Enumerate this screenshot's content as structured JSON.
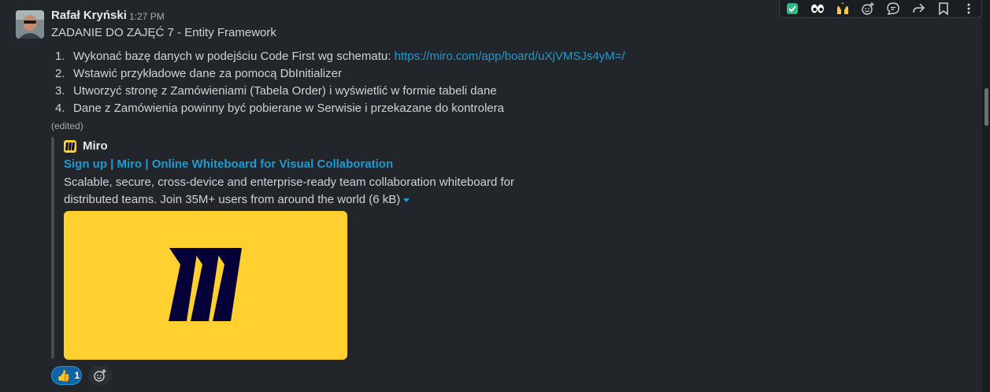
{
  "message": {
    "author": "Rafał Kryński",
    "time": "1:27 PM",
    "title": "ZADANIE DO ZAJĘĆ 7 - Entity Framework",
    "edited": "(edited)",
    "tasks": [
      {
        "num": "1.",
        "text": "Wykonać bazę danych w podejściu Code First wg schematu: ",
        "link": "https://miro.com/app/board/uXjVMSJs4yM=/"
      },
      {
        "num": "2.",
        "text": "Wstawić przykładowe dane za pomocą DbInitializer"
      },
      {
        "num": "3.",
        "text": "Utworzyć stronę z Zamówieniami (Tabela Order) i wyświetlić w formie tabeli dane"
      },
      {
        "num": "4.",
        "text": "Dane z Zamówienia powinny być pobierane w Serwisie i przekazane do kontrolera"
      }
    ]
  },
  "unfurl": {
    "site_name": "Miro",
    "title": "Sign up | Miro | Online Whiteboard for Visual Collaboration",
    "description": "Scalable, secure, cross-device and enterprise-ready team collaboration whiteboard for distributed teams. Join 35M+ users from around the world (6 kB)",
    "preview_icon": "miro-logo-icon"
  },
  "reactions": [
    {
      "emoji": "👍",
      "count": "1",
      "icon": "thumbs-up-icon"
    }
  ],
  "toolbar": {
    "items": [
      "check-mark-icon",
      "eyes-icon",
      "raised-hands-icon",
      "add-reaction-icon",
      "reply-in-thread-icon",
      "forward-icon",
      "bookmark-icon",
      "more-actions-icon"
    ]
  },
  "colors": {
    "link": "#1d9bd1",
    "miro_yellow": "#ffd02f",
    "miro_logo": "#050038",
    "reaction_active": "#1164a3"
  }
}
